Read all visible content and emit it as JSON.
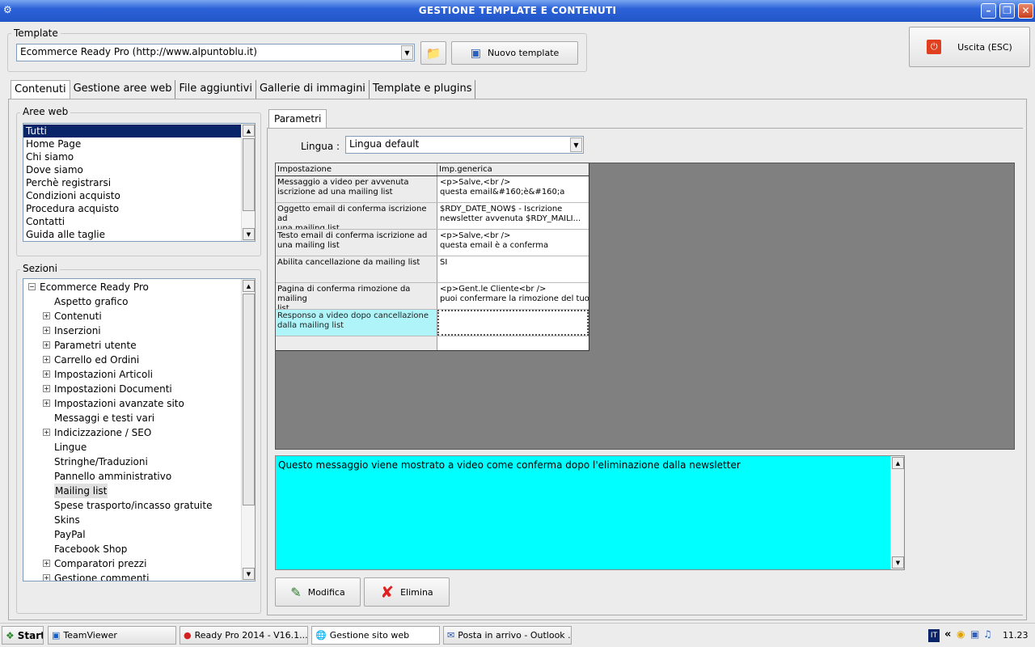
{
  "window": {
    "title": "GESTIONE TEMPLATE E CONTENUTI"
  },
  "template": {
    "group_label": "Template",
    "selected": "Ecommerce Ready Pro (http://www.alpuntoblu.it)",
    "new_button": "Nuovo template"
  },
  "exit_button": "Uscita (ESC)",
  "tabs": [
    {
      "label": "Contenuti"
    },
    {
      "label": "Gestione aree web"
    },
    {
      "label": "File aggiuntivi"
    },
    {
      "label": "Gallerie di immagini"
    },
    {
      "label": "Template e plugins"
    }
  ],
  "aree_web": {
    "label": "Aree web",
    "items": [
      "Tutti",
      "Home Page",
      "Chi siamo",
      "Dove siamo",
      "Perchè registrarsi",
      "Condizioni acquisto",
      "Procedura acquisto",
      "Contatti",
      "Guida alle taglie"
    ]
  },
  "sezioni": {
    "label": "Sezioni",
    "root": "Ecommerce Ready Pro",
    "items": [
      {
        "label": "Aspetto grafico",
        "exp": false
      },
      {
        "label": "Contenuti",
        "exp": true
      },
      {
        "label": "Inserzioni",
        "exp": true
      },
      {
        "label": "Parametri utente",
        "exp": true
      },
      {
        "label": "Carrello ed Ordini",
        "exp": true
      },
      {
        "label": "Impostazioni Articoli",
        "exp": true
      },
      {
        "label": "Impostazioni Documenti",
        "exp": true
      },
      {
        "label": "Impostazioni avanzate sito",
        "exp": true
      },
      {
        "label": "Messaggi e testi vari",
        "exp": false
      },
      {
        "label": "Indicizzazione / SEO",
        "exp": true
      },
      {
        "label": "Lingue",
        "exp": false
      },
      {
        "label": "Stringhe/Traduzioni",
        "exp": false
      },
      {
        "label": "Pannello amministrativo",
        "exp": false
      },
      {
        "label": "Mailing list",
        "exp": false
      },
      {
        "label": "Spese trasporto/incasso gratuite",
        "exp": false
      },
      {
        "label": "Skins",
        "exp": false
      },
      {
        "label": "PayPal",
        "exp": false
      },
      {
        "label": "Facebook Shop",
        "exp": false
      },
      {
        "label": "Comparatori prezzi",
        "exp": true
      },
      {
        "label": "Gestione commenti",
        "exp": true
      }
    ]
  },
  "parametri": {
    "tab": "Parametri",
    "lingua_label": "Lingua :",
    "lingua_value": "Lingua default",
    "headers": [
      "Impostazione",
      "Imp.generica"
    ],
    "rows": [
      {
        "k1": "Messaggio a video per avvenuta",
        "k2": "iscrizione ad una mailing list",
        "v1": "<p>Salve,<br />",
        "v2": "questa email&#160;è&#160;a"
      },
      {
        "k1": "Oggetto email di conferma iscrizione ad",
        "k2": "una mailing list",
        "v1": "$RDY_DATE_NOW$ - Iscrizione",
        "v2": "newsletter avvenuta $RDY_MAILI..."
      },
      {
        "k1": "Testo email di conferma iscrizione ad",
        "k2": "una mailing list",
        "v1": "<p>Salve,<br />",
        "v2": "questa email è a conferma"
      },
      {
        "k1": "Abilita cancellazione da mailing list",
        "k2": "",
        "v1": "SI",
        "v2": ""
      },
      {
        "k1": "Pagina di conferma rimozione da mailing",
        "k2": "list",
        "v1": "<p>Gent.le Cliente<br />",
        "v2": "puoi confermare la rimozione del tuo"
      },
      {
        "k1": "Responso a video dopo cancellazione",
        "k2": "dalla mailing list",
        "v1": "",
        "v2": ""
      }
    ],
    "description": "Questo messaggio viene mostrato a video come conferma dopo l'eliminazione dalla newsletter",
    "modifica": "Modifica",
    "elimina": "Elimina"
  },
  "taskbar": {
    "start": "Start",
    "items": [
      "TeamViewer",
      "Ready Pro 2014 - V16.1...",
      "Gestione sito web",
      "Posta in arrivo - Outlook ..."
    ],
    "lang": "IT",
    "time": "11.23"
  }
}
